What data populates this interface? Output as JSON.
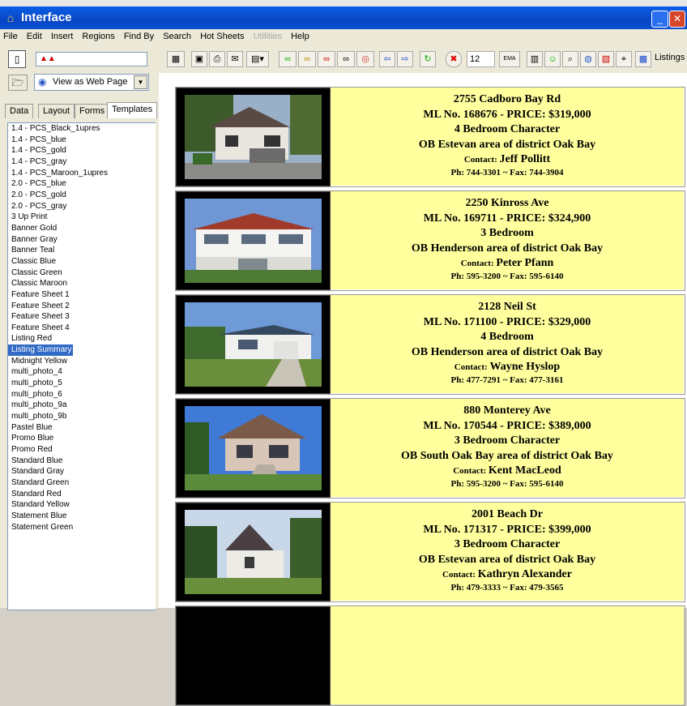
{
  "window": {
    "title": "Interface",
    "min_label": "_",
    "close_label": "✕"
  },
  "menu": [
    "File",
    "Edit",
    "Insert",
    "Regions",
    "Find By",
    "Search",
    "Hot Sheets",
    "Utilities",
    "Help"
  ],
  "left": {
    "view_select": "View as Web Page",
    "tabs": [
      "Data",
      "Layout",
      "Forms",
      "Templates"
    ],
    "active_tab": "Templates",
    "templates": [
      "1.4 - PCS_Black_1upres",
      "1.4 - PCS_blue",
      "1.4 - PCS_gold",
      "1.4 - PCS_gray",
      "1.4 - PCS_Maroon_1upres",
      "2.0 - PCS_blue",
      "2.0 - PCS_gold",
      "2.0 - PCS_gray",
      "3 Up Print",
      "Banner Gold",
      "Banner Gray",
      "Banner Teal",
      "Classic Blue",
      "Classic Green",
      "Classic Maroon",
      "Feature Sheet 1",
      "Feature Sheet 2",
      "Feature Sheet 3",
      "Feature Sheet 4",
      "Listing Red",
      "Listing Summary",
      "Midnight Yellow",
      "multi_photo_4",
      "multi_photo_5",
      "multi_photo_6",
      "multi_photo_9a",
      "multi_photo_9b",
      "Pastel Blue",
      "Promo Blue",
      "Promo Red",
      "Standard Blue",
      "Standard Gray",
      "Standard Green",
      "Standard Red",
      "Standard Yellow",
      "Statement Blue",
      "Statement Green"
    ],
    "selected_template": "Listing Summary"
  },
  "toolbar": {
    "count_value": "12",
    "ema_label": "EMA",
    "listings_label": "Listings"
  },
  "listings": [
    {
      "address": "2755 Cadboro Bay Rd",
      "ml_line": "ML No. 168676 - PRICE: $319,000",
      "type": "4 Bedroom Character",
      "area": "OB Estevan area of district Oak Bay",
      "contact_label": "Contact:",
      "contact": "Jeff Pollitt",
      "phone": "Ph: 744-3301 ~ Fax: 744-3904"
    },
    {
      "address": "2250 Kinross Ave",
      "ml_line": "ML No. 169711 - PRICE: $324,900",
      "type": "3 Bedroom",
      "area": "OB Henderson area of district Oak Bay",
      "contact_label": "Contact:",
      "contact": "Peter Pfann",
      "phone": "Ph: 595-3200 ~ Fax: 595-6140"
    },
    {
      "address": "2128 Neil St",
      "ml_line": "ML No. 171100 - PRICE: $329,000",
      "type": "4 Bedroom",
      "area": "OB Henderson area of district Oak Bay",
      "contact_label": "Contact:",
      "contact": "Wayne Hyslop",
      "phone": "Ph: 477-7291 ~ Fax: 477-3161"
    },
    {
      "address": "880 Monterey Ave",
      "ml_line": "ML No. 170544 - PRICE: $389,000",
      "type": "3 Bedroom Character",
      "area": "OB South Oak Bay area of district Oak Bay",
      "contact_label": "Contact:",
      "contact": "Kent MacLeod",
      "phone": "Ph: 595-3200 ~ Fax: 595-6140"
    },
    {
      "address": "2001 Beach Dr",
      "ml_line": "ML No. 171317 - PRICE: $399,000",
      "type": "3 Bedroom Character",
      "area": "OB Estevan area of district Oak Bay",
      "contact_label": "Contact:",
      "contact": "Kathryn Alexander",
      "phone": "Ph: 479-3333 ~ Fax: 479-3565"
    }
  ],
  "colors": {
    "titlebar": "#0a5ee6",
    "info_bg": "#ffff9e",
    "selection": "#316ac5"
  }
}
